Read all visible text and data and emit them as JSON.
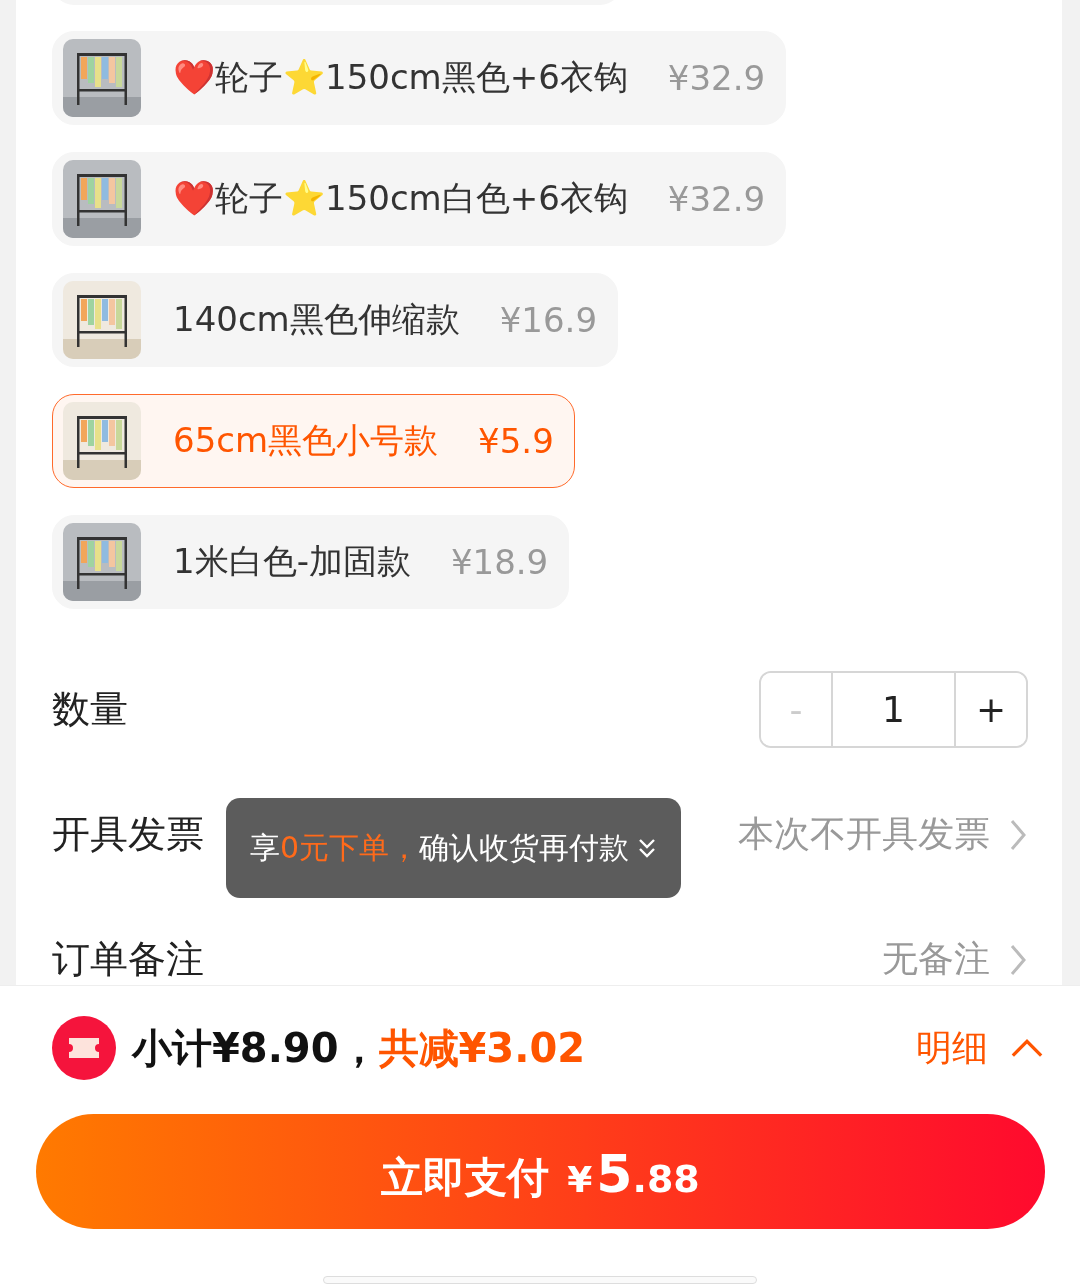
{
  "options": [
    {
      "label": "❤️轮子⭐150cm黑色+6衣钩",
      "price": "¥32.9",
      "selected": false
    },
    {
      "label": "❤️轮子⭐150cm白色+6衣钩",
      "price": "¥32.9",
      "selected": false
    },
    {
      "label": "140cm黑色伸缩款",
      "price": "¥16.9",
      "selected": false
    },
    {
      "label": "65cm黑色小号款",
      "price": "¥5.9",
      "selected": true
    },
    {
      "label": "1米白色-加固款",
      "price": "¥18.9",
      "selected": false
    }
  ],
  "quantity": {
    "label": "数量",
    "minus": "-",
    "value": "1",
    "plus": "+",
    "minus_disabled": true
  },
  "rows": [
    {
      "label": "开具发票",
      "value": "本次不开具发票"
    },
    {
      "label": "订单备注",
      "value": "无备注"
    }
  ],
  "toast": {
    "prefix": "享",
    "highlight": "0元下单，",
    "suffix": "确认收货再付款"
  },
  "summary": {
    "subtotal": "小计¥8.90，",
    "discount": "共减¥3.02",
    "details": "明细",
    "details_expanded": false
  },
  "pay_button": {
    "label": "立即支付",
    "currency": "¥",
    "integer": "5",
    "decimals": ".88"
  }
}
